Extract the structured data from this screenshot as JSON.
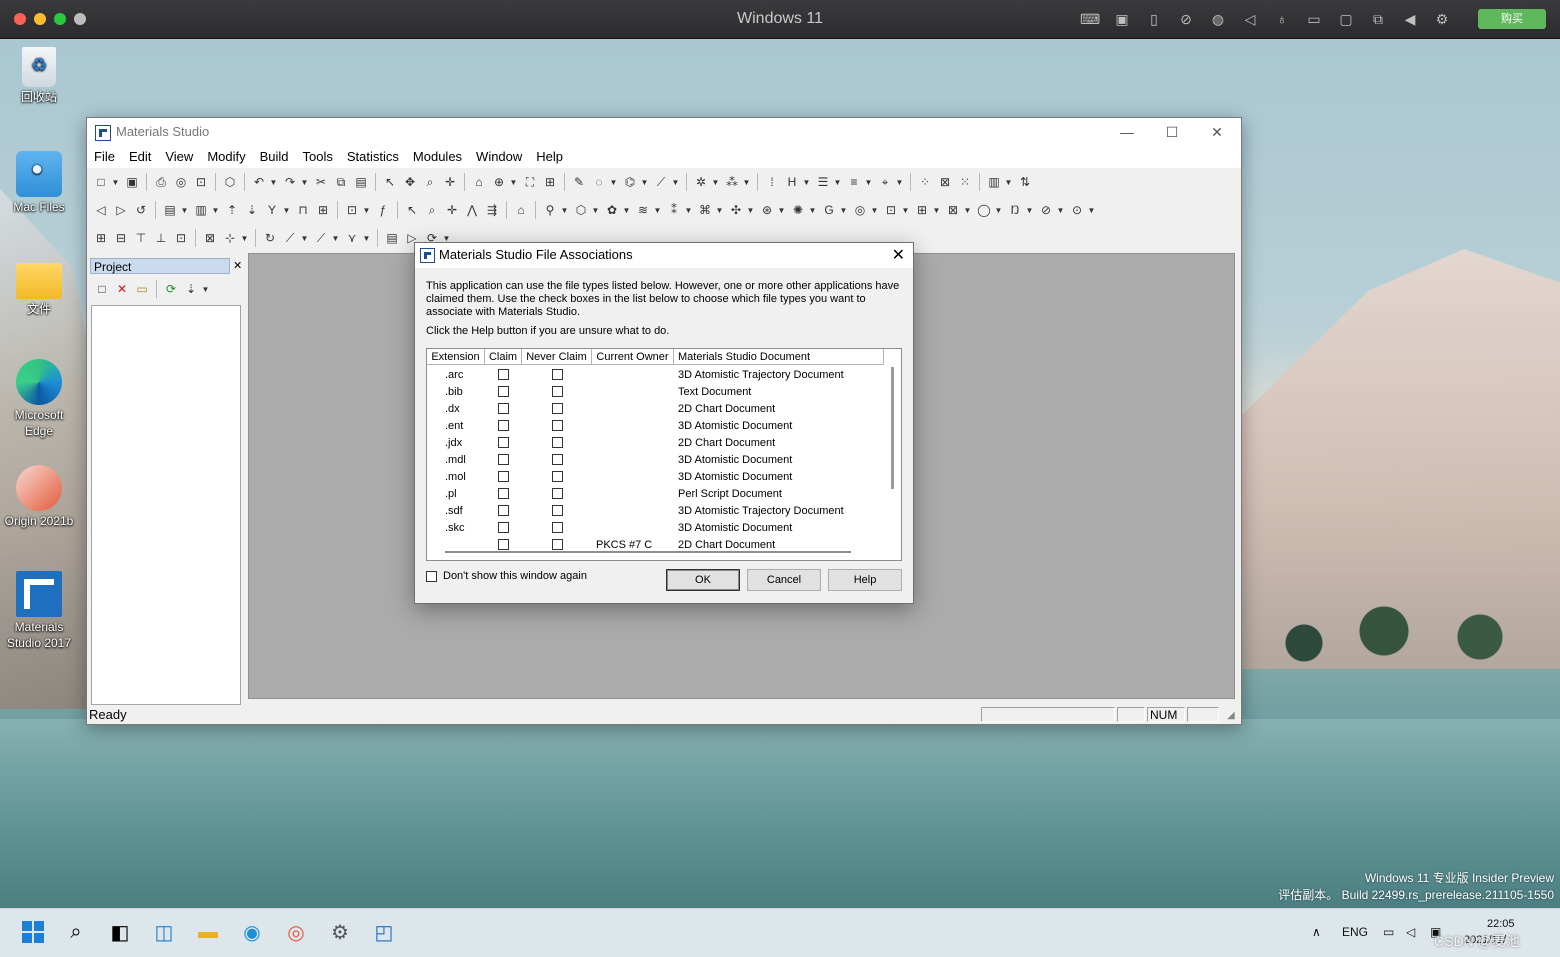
{
  "host": {
    "title": "Windows 11",
    "buy_label": "购买",
    "icons": [
      "keyboard-icon",
      "cpu-icon",
      "usb-icon",
      "camera-off-icon",
      "globe-icon",
      "volume-icon",
      "mic-icon",
      "drive-icon",
      "video-icon",
      "screen-share-icon",
      "arrow-left-icon",
      "gear-icon"
    ]
  },
  "desktop": {
    "icons": [
      {
        "label": "回收站",
        "icon": "recycle-bin-icon"
      },
      {
        "label": "Mac Files",
        "icon": "mac-folder-icon"
      },
      {
        "label": "文件",
        "icon": "folder-icon"
      },
      {
        "label": "Microsoft Edge",
        "icon": "edge-icon"
      },
      {
        "label": "Origin 2021b",
        "icon": "origin-icon"
      },
      {
        "label": "Materials Studio 2017",
        "icon": "materials-studio-icon"
      }
    ],
    "watermark_line1": "Windows 11 专业版 Insider Preview",
    "watermark_line2": "评估副本。 Build 22499.rs_prerelease.211105-1550"
  },
  "taskbar": {
    "lang": "ENG",
    "time": "22:05",
    "date": "2021/11/",
    "csdn": "CSDN @麦池"
  },
  "app": {
    "title": "Materials Studio",
    "menu": [
      "File",
      "Edit",
      "View",
      "Modify",
      "Build",
      "Tools",
      "Statistics",
      "Modules",
      "Window",
      "Help"
    ],
    "project_title": "Project",
    "status_text": "Ready",
    "status_num": "NUM"
  },
  "dialog": {
    "title": "Materials Studio File Associations",
    "message": "This application can use the file types listed below. However, one or more other applications have claimed them. Use the check boxes in the list below to choose which file types you want to associate with Materials Studio.",
    "help_hint": "Click the Help button if you are unsure what to do.",
    "columns": [
      "Extension",
      "Claim",
      "Never Claim",
      "Current Owner",
      "Materials Studio Document"
    ],
    "rows": [
      {
        "ext": ".arc",
        "owner": "",
        "doc": "3D Atomistic Trajectory Document"
      },
      {
        "ext": ".bib",
        "owner": "",
        "doc": "Text Document"
      },
      {
        "ext": ".dx",
        "owner": "",
        "doc": "2D Chart Document"
      },
      {
        "ext": ".ent",
        "owner": "",
        "doc": "3D Atomistic Document"
      },
      {
        "ext": ".jdx",
        "owner": "",
        "doc": "2D Chart Document"
      },
      {
        "ext": ".mdl",
        "owner": "",
        "doc": "3D Atomistic Document"
      },
      {
        "ext": ".mol",
        "owner": "",
        "doc": "3D Atomistic Document"
      },
      {
        "ext": ".pl",
        "owner": "",
        "doc": "Perl Script Document"
      },
      {
        "ext": ".sdf",
        "owner": "",
        "doc": "3D Atomistic Trajectory Document"
      },
      {
        "ext": ".skc",
        "owner": "",
        "doc": "3D Atomistic Document"
      },
      {
        "ext": "",
        "owner": "PKCS #7 C",
        "doc": "2D Chart Document"
      }
    ],
    "dont_show": "Don't show this window again",
    "ok": "OK",
    "cancel": "Cancel",
    "help": "Help"
  }
}
